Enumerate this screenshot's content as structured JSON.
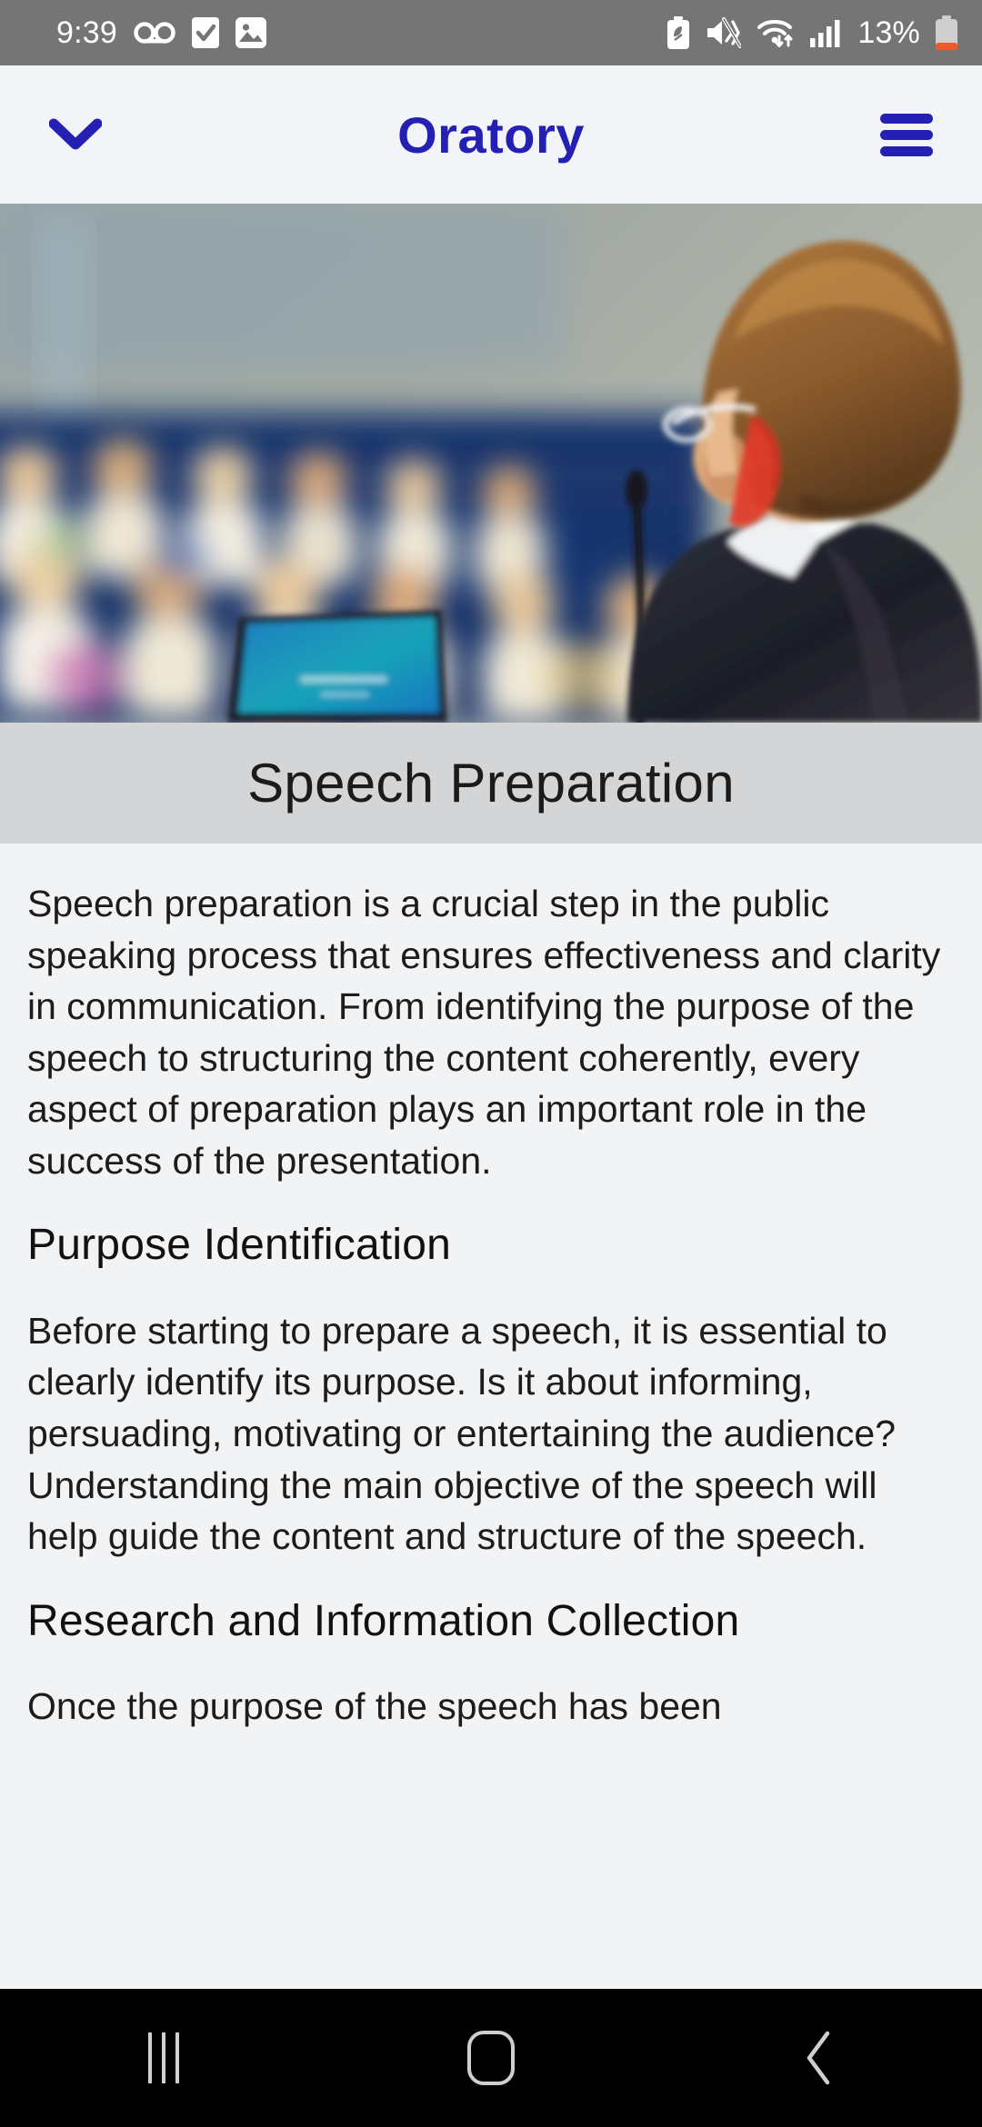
{
  "status_bar": {
    "time": "9:39",
    "battery_percent": "13%",
    "left_icons": [
      "voicemail-icon",
      "tasks-checkbox-icon",
      "gallery-image-icon"
    ],
    "right_icons": [
      "battery-saver-icon",
      "sound-vibrate-off-icon",
      "wifi-icon",
      "cellular-signal-icon",
      "battery-low-icon"
    ],
    "bg_color": "#757575",
    "fg_color": "#ffffff"
  },
  "app_bar": {
    "title": "Oratory",
    "accent_color": "#2320B3",
    "bg_color": "#F2F4F7",
    "left_icon": "chevron-down-icon",
    "right_icon": "hamburger-menu-icon"
  },
  "hero": {
    "alt": "Public speaker in dark suit seen from behind addressing a blurred audience seated in blue auditorium chairs, with a laptop and microphone in the foreground"
  },
  "banner": {
    "title": "Speech Preparation",
    "bg_color": "#D4D5D6",
    "text_color": "#1b1b1b"
  },
  "article": {
    "bg_color": "#F2F3F5",
    "blocks": [
      {
        "type": "paragraph",
        "text": "Speech preparation is a crucial step in the public speaking process that ensures effectiveness and clarity in communication. From identifying the purpose of the speech to structuring the content coherently, every aspect of preparation plays an important role in the success of the presentation."
      },
      {
        "type": "heading",
        "text": "Purpose Identification"
      },
      {
        "type": "paragraph",
        "text": "Before starting to prepare a speech, it is essential to clearly identify its purpose. Is it about informing, persuading, motivating or entertaining the audience? Understanding the main objective of the speech will help guide the content and structure of the speech."
      },
      {
        "type": "heading",
        "text": "Research and Information Collection"
      },
      {
        "type": "paragraph",
        "text": "Once the purpose of the speech has been"
      }
    ]
  },
  "nav_bar": {
    "bg_color": "#000000",
    "buttons": [
      {
        "name": "recents-button",
        "icon": "recents-icon"
      },
      {
        "name": "home-button",
        "icon": "home-icon"
      },
      {
        "name": "back-button",
        "icon": "back-chevron-icon"
      }
    ]
  }
}
